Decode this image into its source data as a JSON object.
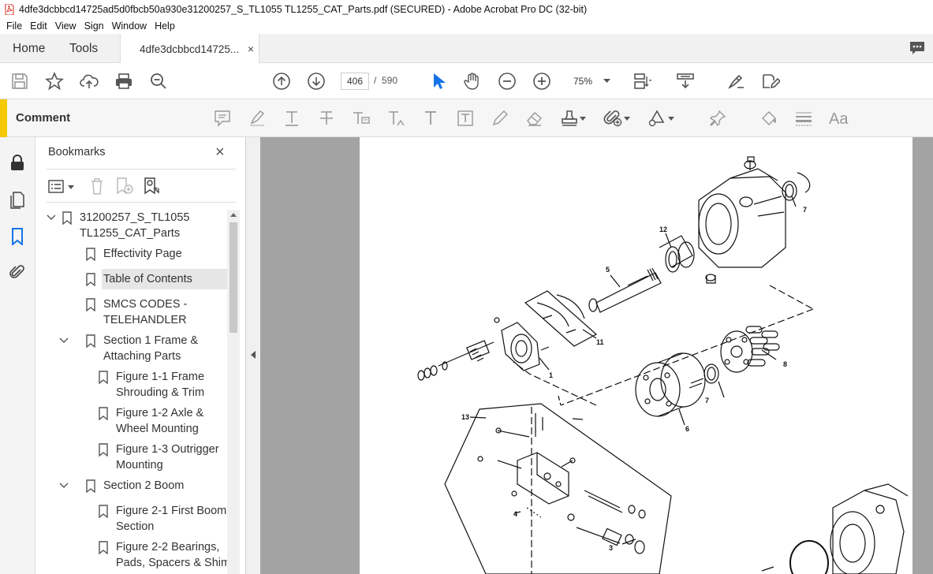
{
  "window": {
    "title": "4dfe3dcbbcd14725ad5d0fbcb50a930e31200257_S_TL1055 TL1255_CAT_Parts.pdf (SECURED) - Adobe Acrobat Pro DC (32-bit)"
  },
  "menu": [
    "File",
    "Edit",
    "View",
    "Sign",
    "Window",
    "Help"
  ],
  "tabs": {
    "home": "Home",
    "tools": "Tools",
    "document": "4dfe3dcbbcd14725...",
    "close_glyph": "×"
  },
  "toolbar": {
    "current_page": "406",
    "separator": "/",
    "total_pages": "590",
    "zoom": "75%"
  },
  "comment_bar": {
    "label": "Comment"
  },
  "bookmarks_panel": {
    "title": "Bookmarks",
    "close_glyph": "×",
    "items": [
      {
        "label": "31200257_S_TL1055",
        "label2": "TL1255_CAT_Parts",
        "level": 0,
        "expanded": true
      },
      {
        "label": "Effectivity Page",
        "level": 1
      },
      {
        "label": "Table of Contents",
        "level": 1,
        "selected": true
      },
      {
        "label": "SMCS CODES -",
        "label2": "TELEHANDLER",
        "level": 1
      },
      {
        "label": "Section 1 Frame &",
        "label2": "Attaching Parts",
        "level": 1,
        "expanded": true
      },
      {
        "label": "Figure 1-1 Frame",
        "label2": "Shrouding & Trim",
        "level": 2
      },
      {
        "label": "Figure 1-2 Axle &",
        "label2": "Wheel Mounting",
        "level": 2
      },
      {
        "label": "Figure 1-3 Outrigger",
        "label2": "Mounting",
        "level": 2
      },
      {
        "label": "Section 2 Boom",
        "level": 1,
        "expanded": true
      },
      {
        "label": "Figure 2-1 First Boom",
        "label2": "Section",
        "level": 2
      },
      {
        "label": "Figure 2-2 Bearings,",
        "label2": "Pads, Spacers & Shims,",
        "level": 2
      }
    ]
  },
  "drawing": {
    "callouts": [
      "1",
      "3",
      "4",
      "5",
      "6",
      "7",
      "8",
      "9",
      "11",
      "12",
      "13"
    ]
  }
}
